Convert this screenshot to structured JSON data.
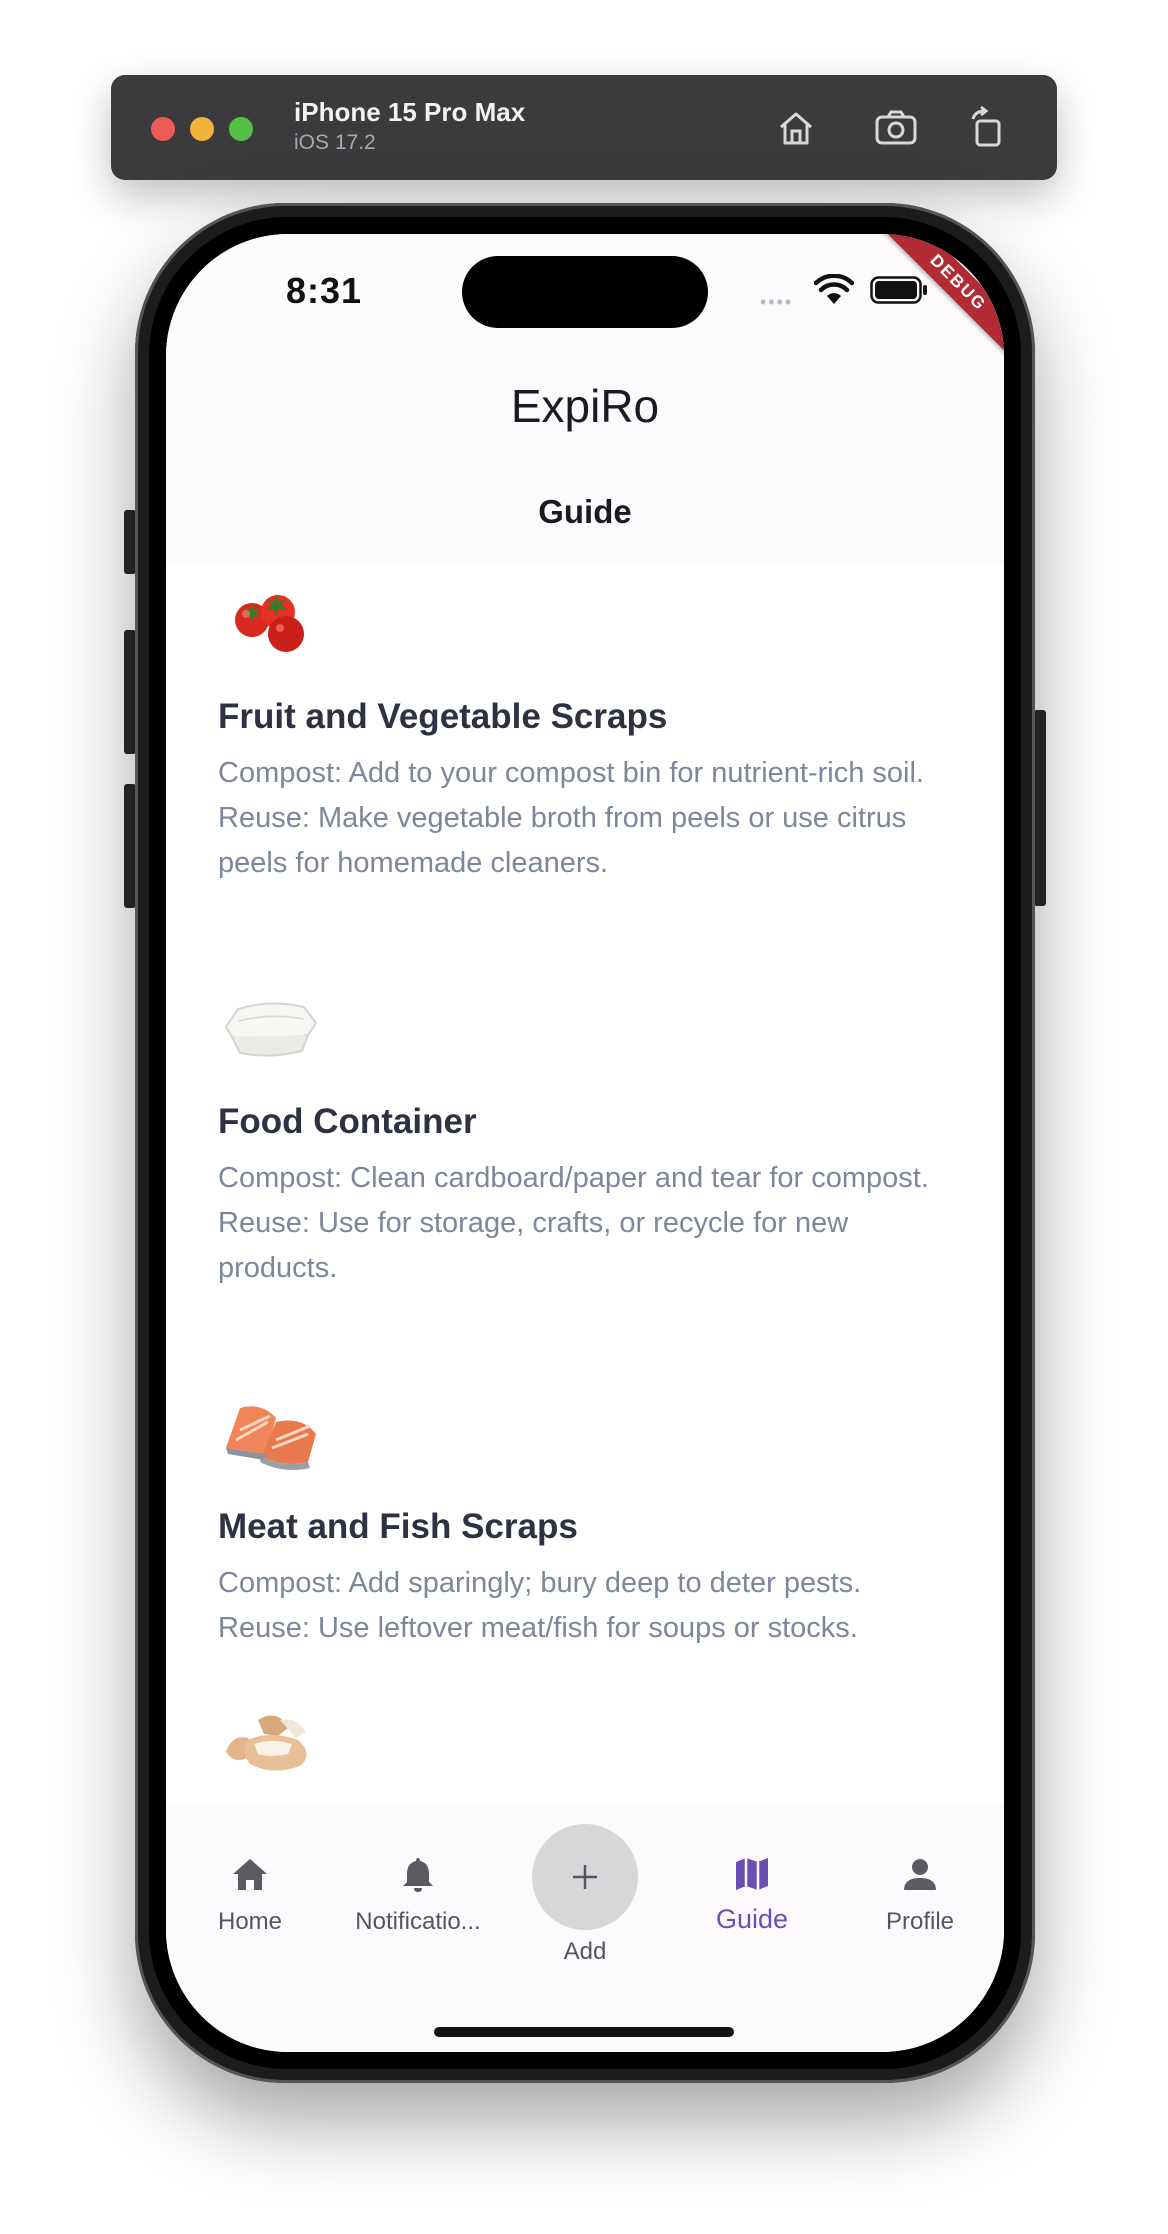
{
  "simulator": {
    "device_name": "iPhone 15 Pro Max",
    "os_version": "iOS 17.2"
  },
  "status_bar": {
    "time": "8:31",
    "debug_label": "DEBUG"
  },
  "app": {
    "title": "ExpiRo",
    "page_title": "Guide"
  },
  "guide_items": [
    {
      "icon": "tomato-image",
      "title": "Fruit and Vegetable Scraps",
      "compost": "Compost: Add to your compost bin for nutrient-rich soil.",
      "reuse": "Reuse: Make vegetable broth from peels or use citrus peels for homemade cleaners."
    },
    {
      "icon": "food-container-image",
      "title": "Food Container",
      "compost": "Compost: Clean cardboard/paper and tear for compost.",
      "reuse": "Reuse: Use for storage, crafts, or recycle for new products."
    },
    {
      "icon": "salmon-image",
      "title": "Meat and Fish Scraps",
      "compost": "Compost: Add sparingly; bury deep to deter pests.",
      "reuse": "Reuse: Use leftover meat/fish for soups or stocks."
    },
    {
      "icon": "eggshell-image"
    }
  ],
  "bottom_nav": {
    "home": "Home",
    "notifications": "Notificatio...",
    "add": "Add",
    "add_symbol": "+",
    "guide": "Guide",
    "profile": "Profile",
    "active": "guide",
    "active_color": "#6a4fb4"
  }
}
